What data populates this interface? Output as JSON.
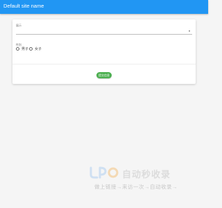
{
  "appbar": {
    "title": "Default site name"
  },
  "form": {
    "select": {
      "label": "展示",
      "value": ""
    },
    "gender": {
      "label": "性别",
      "options": [
        {
          "label": "男子",
          "selected": false
        },
        {
          "label": "女子",
          "selected": false
        }
      ]
    },
    "submit_label": "提交信息"
  },
  "watermark": {
    "brand": "自动秒收录",
    "tagline": "做上链接→来访一次→自动收录→"
  },
  "colors": {
    "appbar": "#2196f3",
    "button": "#4caf50",
    "background": "#f5f5f5"
  }
}
